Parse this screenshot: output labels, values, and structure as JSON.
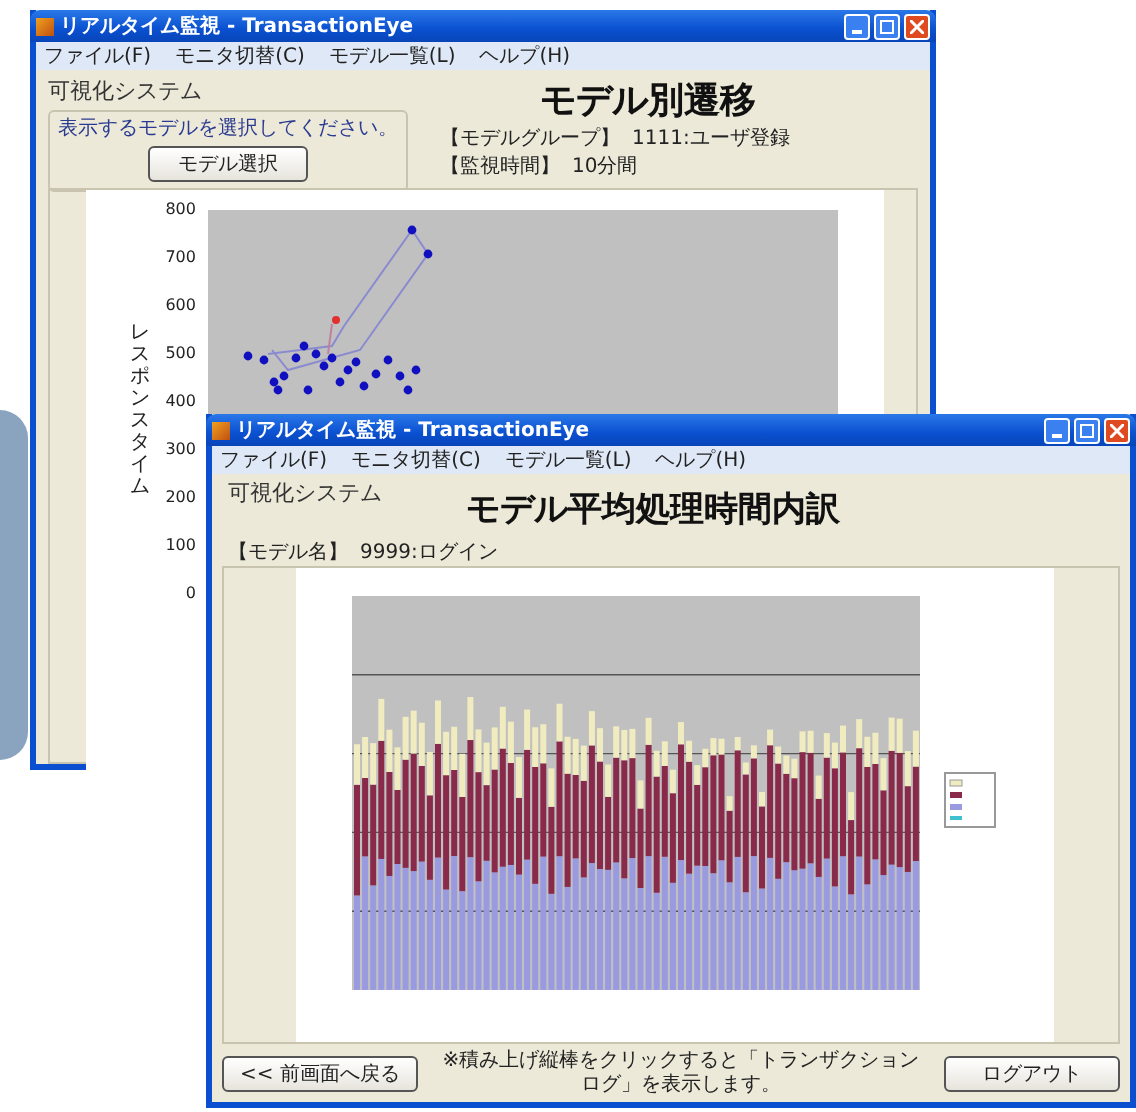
{
  "back_window": {
    "title": "リアルタイム監視 - TransactionEye",
    "menu": [
      "ファイル(F)",
      "モニタ切替(C)",
      "モデル一覧(L)",
      "ヘルプ(H)"
    ],
    "system_name": "可視化システム",
    "heading": "モデル別遷移",
    "group_label": "表示するモデルを選択してください。",
    "select_button": "モデル選択",
    "info": [
      {
        "label": "【モデルグループ】",
        "value": "1111:ユーザ登録"
      },
      {
        "label": "【監視時間】",
        "value": "10分間"
      }
    ],
    "chart": {
      "y_label": "レスポンスタイム",
      "y_ticks": [
        "800",
        "700",
        "600",
        "500",
        "400",
        "300",
        "200",
        "100",
        "0"
      ]
    }
  },
  "front_window": {
    "title": "リアルタイム監視 - TransactionEye",
    "menu": [
      "ファイル(F)",
      "モニタ切替(C)",
      "モデル一覧(L)",
      "ヘルプ(H)"
    ],
    "system_name": "可視化システム",
    "heading": "モデル平均処理時間内訳",
    "model": {
      "label": "【モデル名】",
      "value": "9999:ログイン"
    },
    "back_button": "<< 前画面へ戻る",
    "note": "※積み上げ縦棒をクリックすると「トランザクションログ」を表示します。",
    "logout_button": "ログアウト"
  }
}
